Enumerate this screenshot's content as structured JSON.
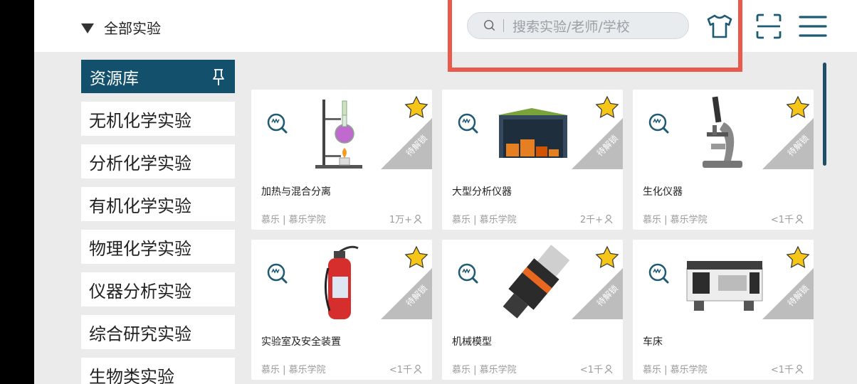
{
  "header": {
    "filter_label": "全部实验",
    "search_placeholder": "搜索实验/老师/学校"
  },
  "sidebar": {
    "title": "资源库",
    "items": [
      "无机化学实验",
      "分析化学实验",
      "有机化学实验",
      "物理化学实验",
      "仪器分析实验",
      "综合研究实验",
      "生物类实验"
    ]
  },
  "cards": [
    {
      "title": "加热与混合分离",
      "meta": "慕乐 | 慕乐学院",
      "count": "1万+",
      "badge": "待解锁"
    },
    {
      "title": "大型分析仪器",
      "meta": "慕乐 | 慕乐学院",
      "count": "2千+",
      "badge": "待解锁"
    },
    {
      "title": "生化仪器",
      "meta": "慕乐 | 慕乐学院",
      "count": "<1千",
      "badge": "待解锁"
    },
    {
      "title": "实验室及安全装置",
      "meta": "慕乐 | 慕乐学院",
      "count": "<1千",
      "badge": "待解锁"
    },
    {
      "title": "机械模型",
      "meta": "慕乐 | 慕乐学院",
      "count": "<1千",
      "badge": "待解锁"
    },
    {
      "title": "车床",
      "meta": "慕乐 | 慕乐学院",
      "count": "<1千",
      "badge": "待解锁"
    }
  ],
  "colors": {
    "sidebar_header_bg": "#12506c",
    "highlight_border": "#ea5a4c",
    "star": "#f5c518",
    "ribbon": "#bdbdbd",
    "scrollbar": "#1e4f66"
  },
  "icons": {
    "filter": "caret-down-icon",
    "search": "search-icon",
    "shirt": "shirt-icon",
    "scan": "scan-icon",
    "menu": "menu-icon",
    "pin": "pin-icon",
    "star": "star-icon",
    "vr": "vr-search-icon",
    "user": "user-icon"
  }
}
